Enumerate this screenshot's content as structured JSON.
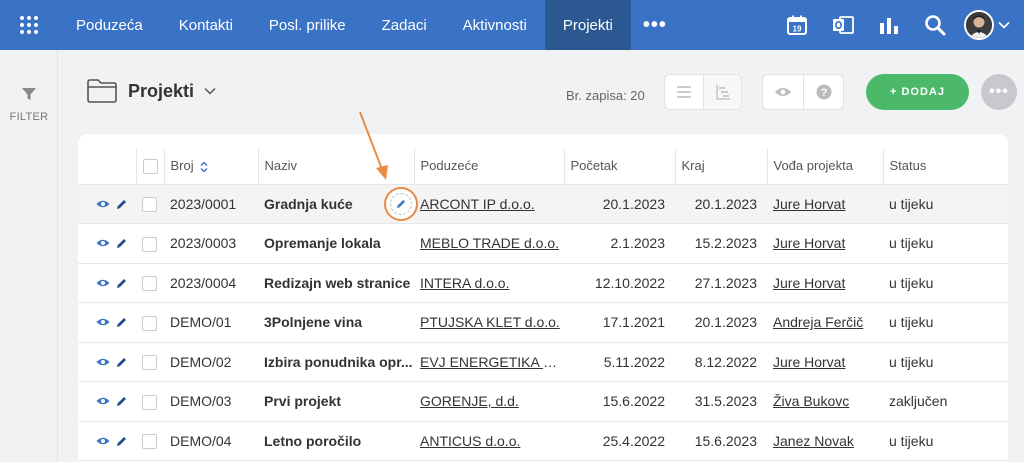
{
  "nav": {
    "items": [
      {
        "label": "Poduzeća",
        "active": false
      },
      {
        "label": "Kontakti",
        "active": false
      },
      {
        "label": "Posl. prilike",
        "active": false
      },
      {
        "label": "Zadaci",
        "active": false
      },
      {
        "label": "Aktivnosti",
        "active": false
      },
      {
        "label": "Projekti",
        "active": true
      }
    ],
    "calendar_day": "19",
    "colors": {
      "bar": "#3a73c5",
      "active": "#2c5892"
    }
  },
  "sidebar": {
    "filter_label": "FILTER"
  },
  "header": {
    "title": "Projekti",
    "records_label": "Br. zapisa: 20",
    "add_label": "+ DODAJ"
  },
  "table": {
    "columns": [
      "Broj",
      "Naziv",
      "Poduzeće",
      "Početak",
      "Kraj",
      "Vođa projekta",
      "Status"
    ],
    "rows": [
      {
        "broj": "2023/0001",
        "naziv": "Gradnja kuće",
        "poduzece": "ARCONT IP d.o.o.",
        "pocetak": "20.1.2023",
        "kraj": "20.1.2023",
        "voda": "Jure Horvat",
        "status": "u tijeku"
      },
      {
        "broj": "2023/0003",
        "naziv": "Opremanje lokala",
        "poduzece": "MEBLO TRADE d.o.o.",
        "pocetak": "2.1.2023",
        "kraj": "15.2.2023",
        "voda": "Jure Horvat",
        "status": "u tijeku"
      },
      {
        "broj": "2023/0004",
        "naziv": "Redizajn web stranice",
        "poduzece": "INTERA d.o.o.",
        "pocetak": "12.10.2022",
        "kraj": "27.1.2023",
        "voda": "Jure Horvat",
        "status": "u tijeku"
      },
      {
        "broj": "DEMO/01",
        "naziv": "3Polnjene vina",
        "poduzece": "PTUJSKA KLET d.o.o.",
        "pocetak": "17.1.2021",
        "kraj": "20.1.2023",
        "voda": "Andreja Ferčič",
        "status": "u tijeku"
      },
      {
        "broj": "DEMO/02",
        "naziv": "Izbira ponudnika opr...",
        "poduzece": "EVJ ENERGETIKA d.o.o.",
        "pocetak": "5.11.2022",
        "kraj": "8.12.2022",
        "voda": "Jure Horvat",
        "status": "u tijeku"
      },
      {
        "broj": "DEMO/03",
        "naziv": "Prvi projekt",
        "poduzece": "GORENJE, d.d.",
        "pocetak": "15.6.2022",
        "kraj": "31.5.2023",
        "voda": "Živa Bukovc",
        "status": "zaključen"
      },
      {
        "broj": "DEMO/04",
        "naziv": "Letno poročilo",
        "poduzece": "ANTICUS d.o.o.",
        "pocetak": "25.4.2022",
        "kraj": "15.6.2023",
        "voda": "Janez Novak",
        "status": "u tijeku"
      }
    ]
  },
  "icons": {
    "apps": "grid-icon",
    "more": "dots-icon",
    "calendar": "calendar-icon",
    "outlook": "outlook-icon",
    "reports": "bar-chart-icon",
    "search": "search-icon",
    "filter": "funnel-icon",
    "folder": "folder-icon",
    "view": "eye-icon",
    "edit": "pencil-icon"
  },
  "accent": {
    "add_button": "#4cb86a",
    "annotation": "#ea8a44",
    "icon_blue": "#3a73c5"
  }
}
